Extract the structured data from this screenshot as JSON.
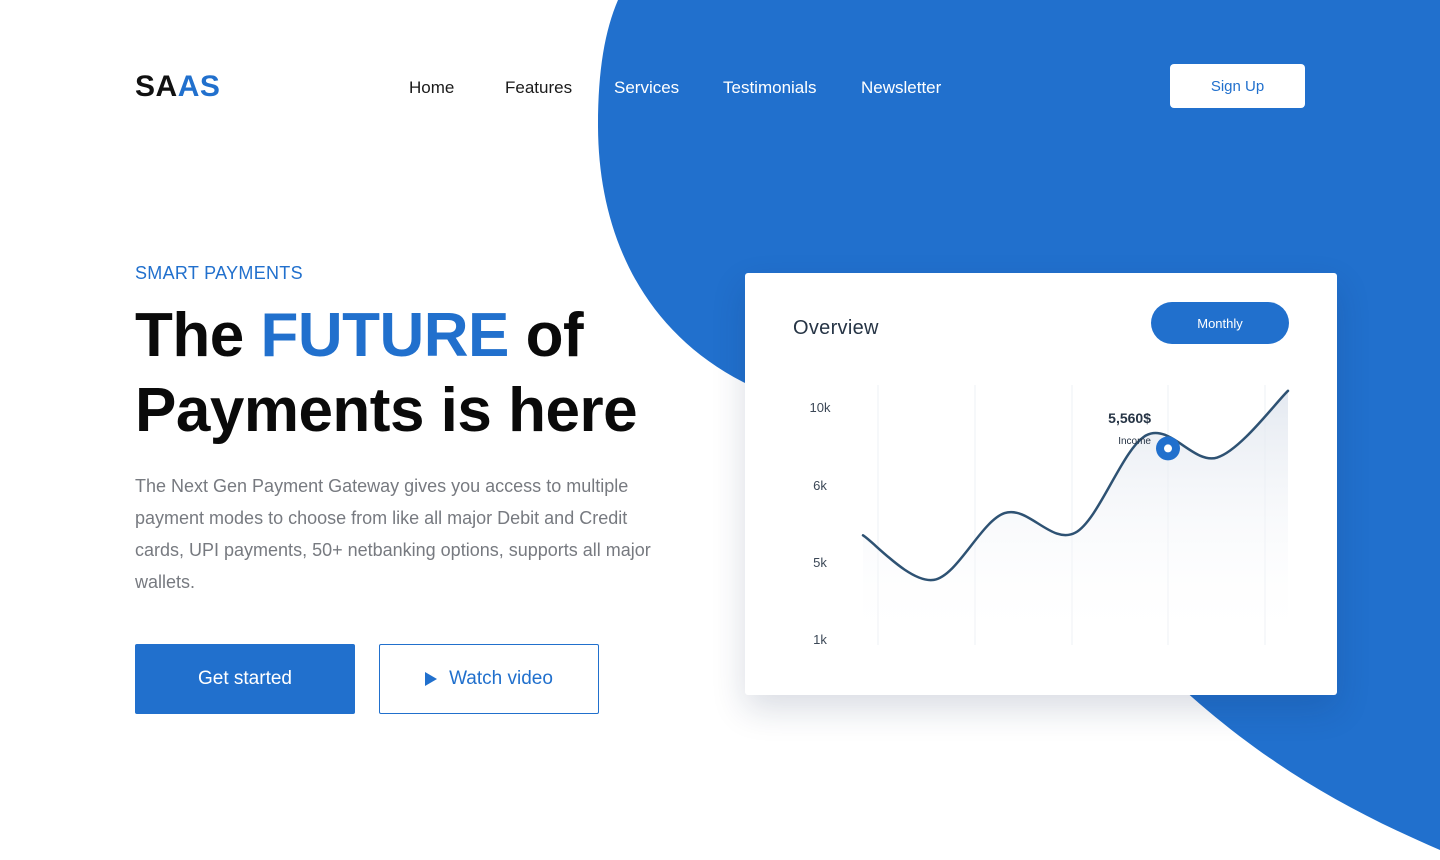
{
  "brand": {
    "logo_part1": "SA",
    "logo_part2": "AS"
  },
  "nav": {
    "items": [
      {
        "label": "Home"
      },
      {
        "label": "Features"
      },
      {
        "label": "Services"
      },
      {
        "label": "Testimonials"
      },
      {
        "label": "Newsletter"
      }
    ],
    "signup_label": "Sign Up"
  },
  "hero": {
    "eyebrow": "SMART PAYMENTS",
    "headline_pre": "The ",
    "headline_accent": "FUTURE",
    "headline_post": " of",
    "headline_line2": "Payments is here",
    "description": "The Next Gen Payment Gateway gives you access to multiple payment modes to choose from like all major Debit and Credit cards, UPI payments, 50+ netbanking options, supports all major wallets.",
    "primary_cta": "Get started",
    "secondary_cta": "Watch video"
  },
  "card": {
    "title": "Overview",
    "period_label": "Monthly"
  },
  "chart_data": {
    "type": "area",
    "title": "Overview",
    "y_tick_labels": [
      "10k",
      "6k",
      "5k",
      "1k"
    ],
    "grid": "vertical",
    "series": [
      {
        "values": [
          4.8,
          3.2,
          5.6,
          4.9,
          8.4,
          7.6,
          10
        ]
      }
    ],
    "annotation": {
      "value": "5,560$",
      "label": "Income"
    }
  },
  "colors": {
    "accent": "#2170cd",
    "line": "#2e5273",
    "text_muted": "#777a80"
  }
}
